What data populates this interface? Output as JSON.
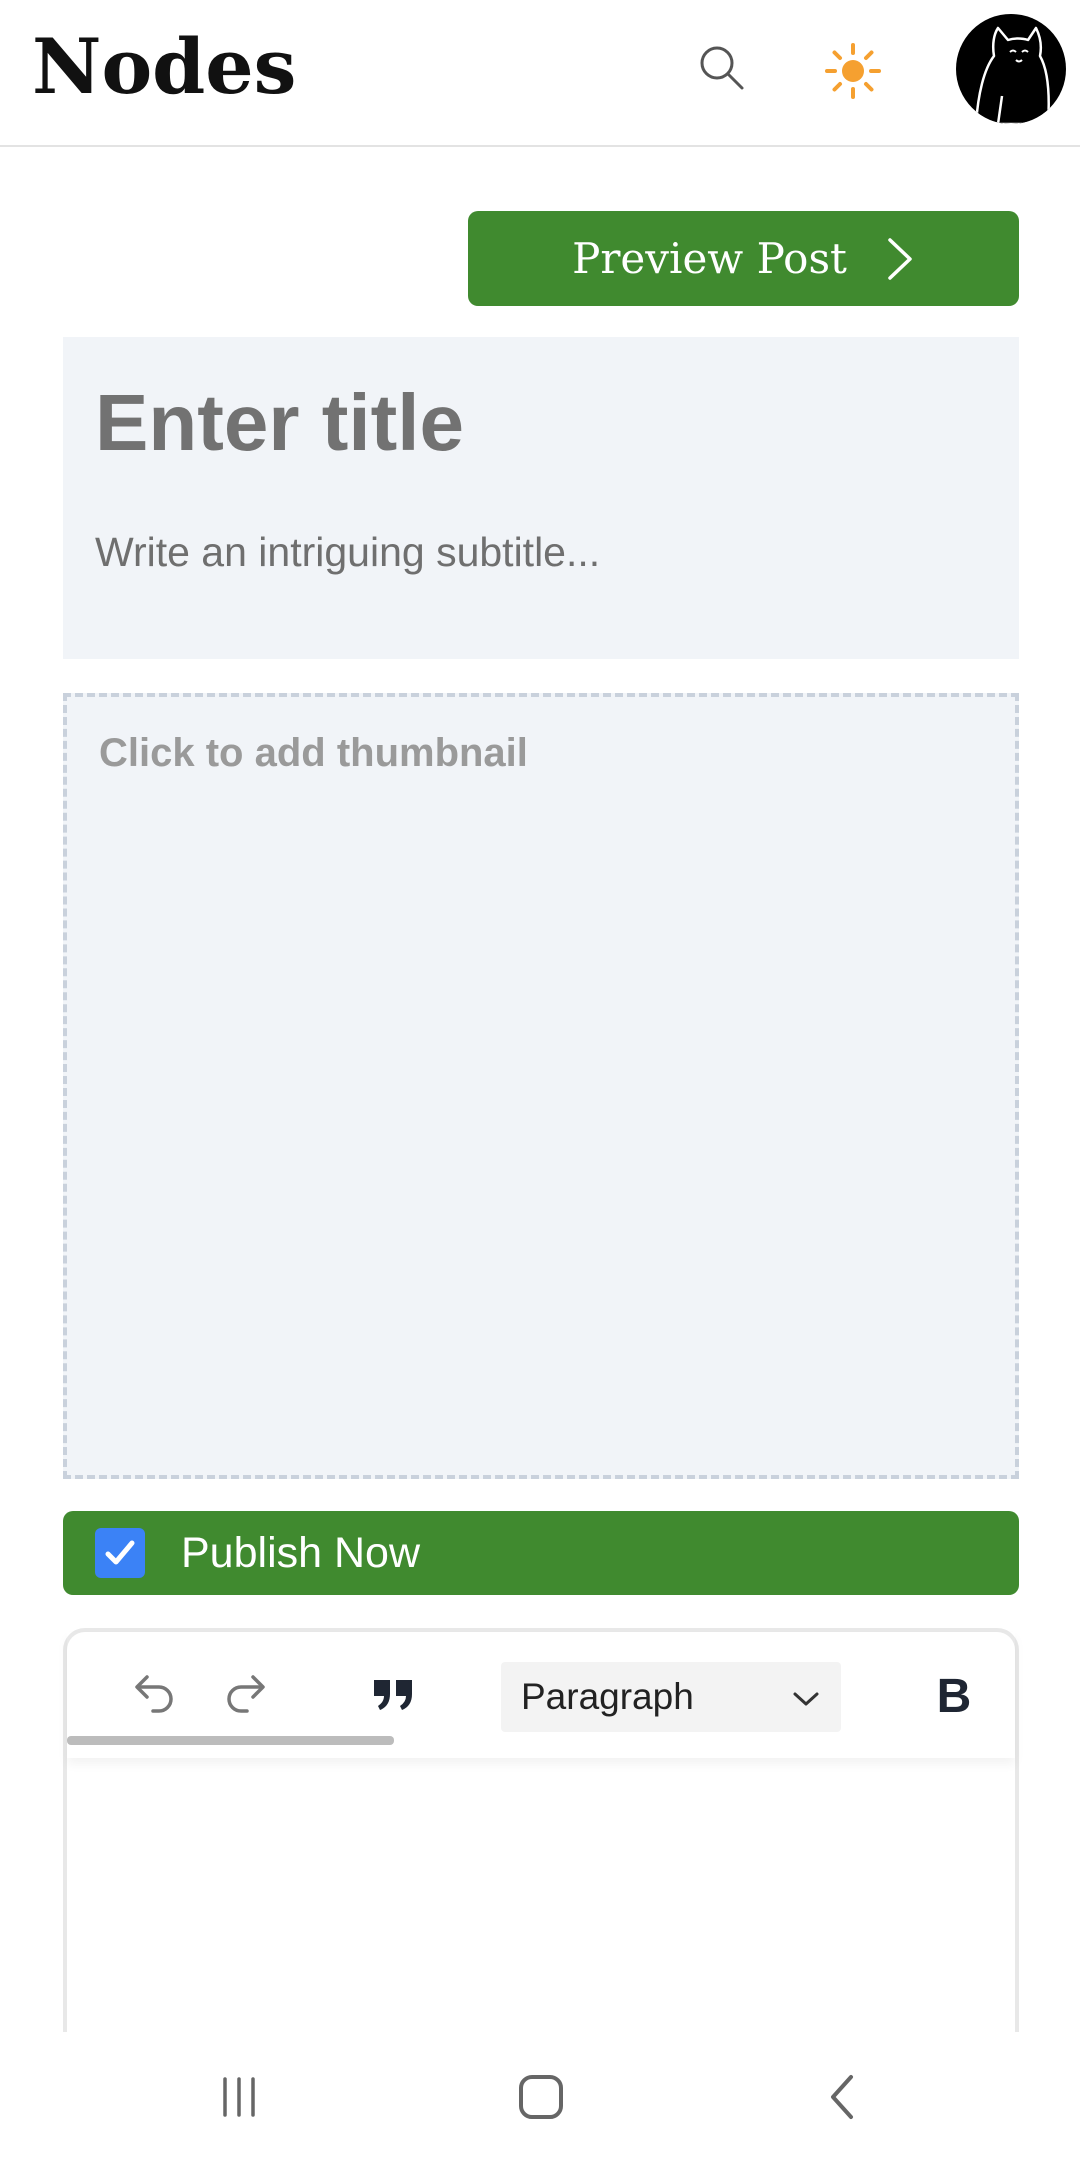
{
  "header": {
    "logo": "Nodes",
    "icons": {
      "search": "search-icon",
      "theme": "sun-icon",
      "avatar": "cat-avatar"
    },
    "accent_sun": "#f5a030"
  },
  "editor_page": {
    "preview_label": "Preview Post",
    "title_placeholder": "Enter title",
    "subtitle_placeholder": "Write an intriguing subtitle...",
    "thumbnail_label": "Click to add thumbnail",
    "publish_label": "Publish Now",
    "publish_checked": true
  },
  "toolbar": {
    "block_type": "Paragraph",
    "bold_label": "B",
    "icons": [
      "undo-icon",
      "redo-icon",
      "quote-icon",
      "chevron-down-icon"
    ]
  },
  "colors": {
    "primary_green": "#408a2f",
    "checkbox_blue": "#3b82f6",
    "field_bg": "#f1f4f8"
  }
}
